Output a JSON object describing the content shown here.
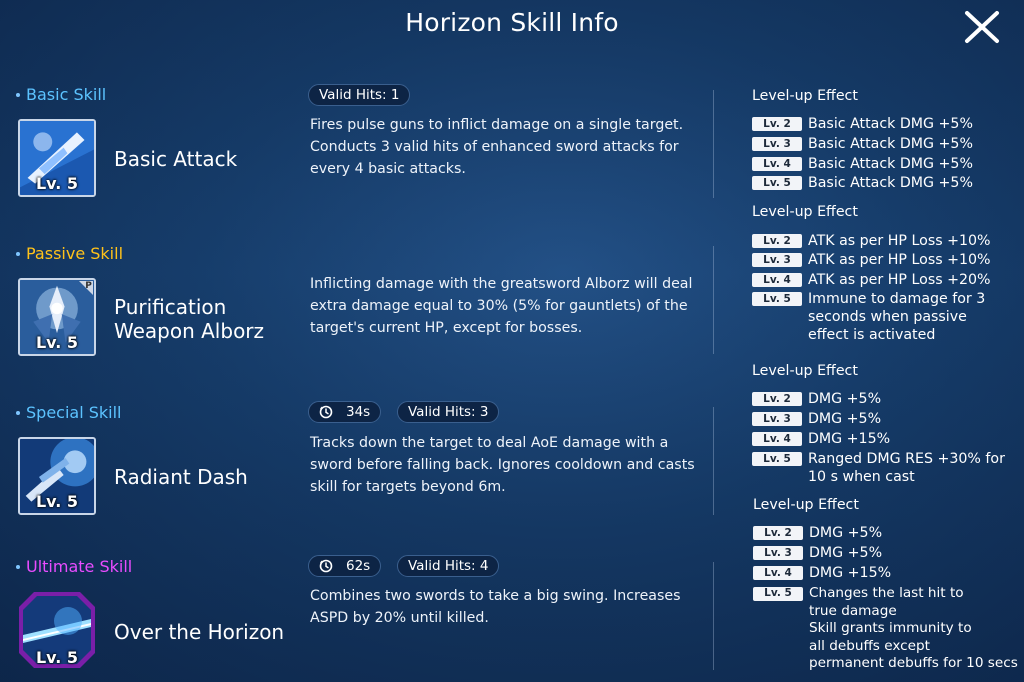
{
  "title": "Horizon Skill Info",
  "close_icon": "close-icon",
  "skills": [
    {
      "type": "Basic Skill",
      "name": "Basic Attack",
      "level_badge": "Lv. 5",
      "meta": {
        "valid_hits": "Valid Hits: 1"
      },
      "description": "Fires pulse guns to inflict damage on a single target. Conducts 3 valid hits of enhanced sword attacks for every 4 basic attacks.",
      "levelup_title": "Level-up Effect",
      "levelup": [
        {
          "lv": "Lv. 2",
          "text": "Basic Attack DMG +5%"
        },
        {
          "lv": "Lv. 3",
          "text": "Basic Attack DMG +5%"
        },
        {
          "lv": "Lv. 4",
          "text": "Basic Attack DMG +5%"
        },
        {
          "lv": "Lv. 5",
          "text": "Basic Attack DMG +5%"
        }
      ]
    },
    {
      "type": "Passive Skill",
      "name": "Purification\nWeapon Alborz",
      "level_badge": "Lv. 5",
      "passive_badge": "P",
      "description": "Inflicting damage with the greatsword Alborz will deal extra damage equal to 30% (5% for gauntlets) of the target's current HP, except for bosses.",
      "levelup_title": "Level-up Effect",
      "levelup": [
        {
          "lv": "Lv. 2",
          "text": "ATK as per HP Loss +10%"
        },
        {
          "lv": "Lv. 3",
          "text": "ATK as per HP Loss +10%"
        },
        {
          "lv": "Lv. 4",
          "text": "ATK as per HP Loss +20%"
        },
        {
          "lv": "Lv. 5",
          "text": "Immune to damage for 3\nseconds when passive\neffect is activated"
        }
      ]
    },
    {
      "type": "Special Skill",
      "name": "Radiant Dash",
      "level_badge": "Lv. 5",
      "meta": {
        "cooldown": "34s",
        "valid_hits": "Valid Hits: 3"
      },
      "description": "Tracks down the target to deal AoE damage with a sword before falling back. Ignores cooldown and casts skill for targets beyond 6m.",
      "levelup_title": "Level-up Effect",
      "levelup": [
        {
          "lv": "Lv. 2",
          "text": "DMG +5%"
        },
        {
          "lv": "Lv. 3",
          "text": "DMG +5%"
        },
        {
          "lv": "Lv. 4",
          "text": "DMG +15%"
        },
        {
          "lv": "Lv. 5",
          "text": "Ranged DMG RES +30% for\n10 s when cast"
        }
      ]
    },
    {
      "type": "Ultimate Skill",
      "name": "Over the Horizon",
      "level_badge": "Lv. 5",
      "meta": {
        "cooldown": "62s",
        "valid_hits": "Valid Hits: 4"
      },
      "description": "Combines two swords to take a big swing. Increases ASPD by 20% until killed.",
      "levelup_title": "Level-up Effect",
      "levelup": [
        {
          "lv": "Lv. 2",
          "text": "DMG +5%"
        },
        {
          "lv": "Lv. 3",
          "text": "DMG +5%"
        },
        {
          "lv": "Lv. 4",
          "text": "DMG +15%"
        },
        {
          "lv": "Lv. 5",
          "text": "Changes the last hit to\ntrue damage\nSkill grants immunity to\nall debuffs except\npermanent debuffs for 10 secs"
        }
      ]
    }
  ],
  "colors": {
    "basic": "#5cc3ff",
    "passive": "#ffc21a",
    "special": "#5cc3ff",
    "ultimate": "#e94cff"
  }
}
